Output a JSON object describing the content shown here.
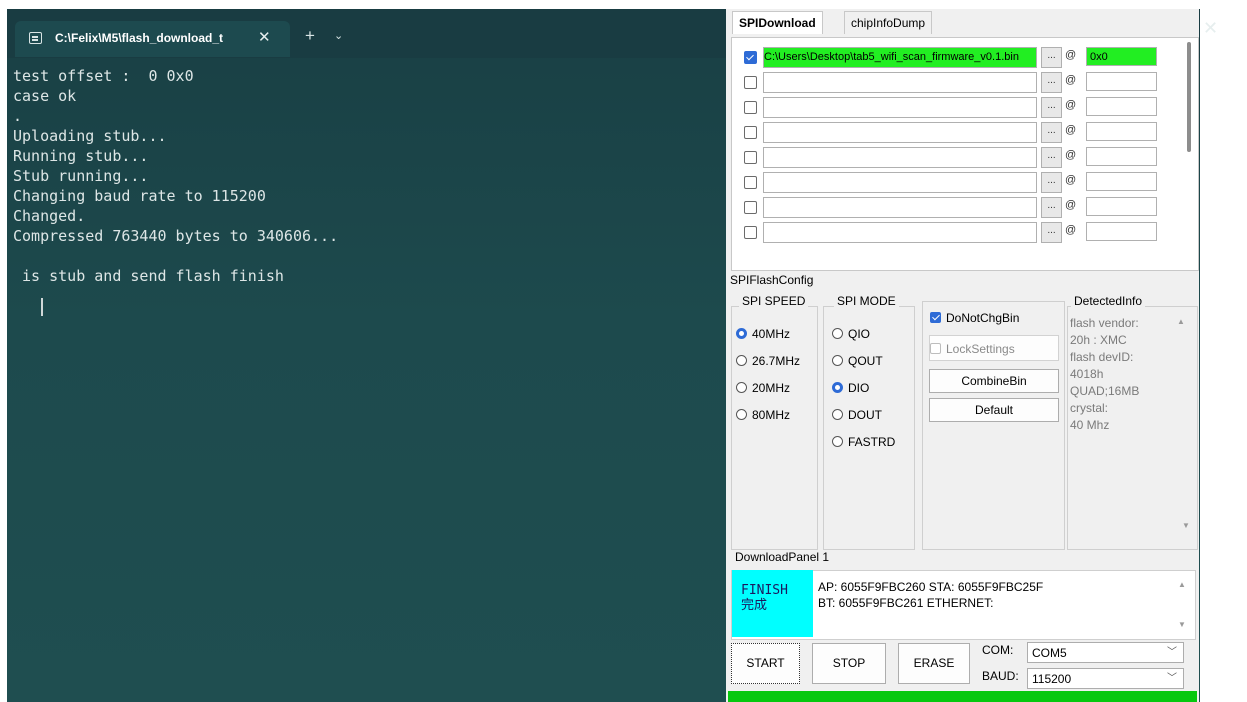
{
  "terminal": {
    "tab_title": "C:\\Felix\\M5\\flash_download_t",
    "tab_close": "✕",
    "new_tab": "+",
    "dropdown": "⌄",
    "window_close": "✕",
    "lines": [
      "test offset :  0 0x0",
      "case ok",
      ".",
      "Uploading stub...",
      "Running stub...",
      "Stub running...",
      "Changing baud rate to 115200",
      "Changed.",
      "Compressed 763440 bytes to 340606...",
      "",
      " is stub and send flash finish"
    ]
  },
  "tool": {
    "tabs": [
      "SPIDownload",
      "chipInfoDump"
    ],
    "files": [
      {
        "checked": true,
        "path": "C:\\Users\\Desktop\\tab5_wifi_scan_firmware_v0.1.bin",
        "offset": "0x0",
        "browse": "...",
        "at": "@"
      },
      {
        "checked": false,
        "path": "",
        "offset": "",
        "browse": "...",
        "at": "@"
      },
      {
        "checked": false,
        "path": "",
        "offset": "",
        "browse": "...",
        "at": "@"
      },
      {
        "checked": false,
        "path": "",
        "offset": "",
        "browse": "...",
        "at": "@"
      },
      {
        "checked": false,
        "path": "",
        "offset": "",
        "browse": "...",
        "at": "@"
      },
      {
        "checked": false,
        "path": "",
        "offset": "",
        "browse": "...",
        "at": "@"
      },
      {
        "checked": false,
        "path": "",
        "offset": "",
        "browse": "...",
        "at": "@"
      },
      {
        "checked": false,
        "path": "",
        "offset": "",
        "browse": "...",
        "at": "@"
      }
    ],
    "spiflash": {
      "title": "SPIFlashConfig",
      "speed_title": "SPI SPEED",
      "speeds": [
        "40MHz",
        "26.7MHz",
        "20MHz",
        "80MHz"
      ],
      "speed_selected": "40MHz",
      "mode_title": "SPI MODE",
      "modes": [
        "QIO",
        "QOUT",
        "DIO",
        "DOUT",
        "FASTRD"
      ],
      "mode_selected": "DIO",
      "donotchgbin": "DoNotChgBin",
      "locksettings": "LockSettings",
      "combinebin": "CombineBin",
      "default": "Default",
      "detected_title": "DetectedInfo",
      "detected_text": "flash vendor:\n20h : XMC\nflash devID:\n4018h\nQUAD;16MB\ncrystal:\n40 Mhz"
    },
    "download": {
      "title": "DownloadPanel 1",
      "status": "FINISH\n完成",
      "mac_info": "AP:  6055F9FBC260  STA:  6055F9FBC25F\nBT:  6055F9FBC261  ETHERNET:"
    },
    "buttons": {
      "start": "START",
      "stop": "STOP",
      "erase": "ERASE"
    },
    "com_label": "COM:",
    "com_value": "COM5",
    "baud_label": "BAUD:",
    "baud_value": "115200",
    "progress": 1.0,
    "colors": {
      "progress": "#07c80f",
      "finish_bg": "#00ffff",
      "file_ok": "#22ee22"
    }
  }
}
